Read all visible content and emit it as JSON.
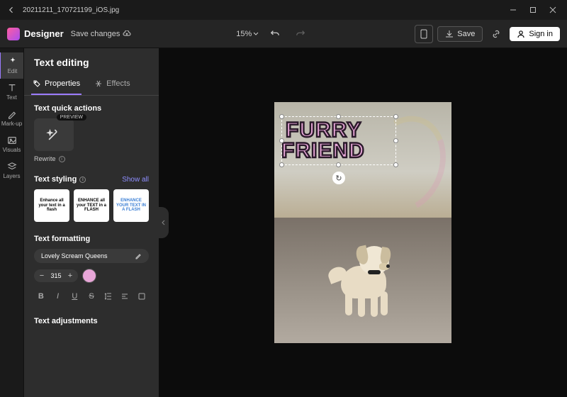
{
  "titlebar": {
    "filename": "20211211_170721199_iOS.jpg"
  },
  "toolbar": {
    "brand": "Designer",
    "save_changes": "Save changes",
    "zoom": "15%",
    "save_label": "Save",
    "signin_label": "Sign in"
  },
  "rail": {
    "items": [
      {
        "label": "Edit"
      },
      {
        "label": "Text"
      },
      {
        "label": "Mark-up"
      },
      {
        "label": "Visuals"
      },
      {
        "label": "Layers"
      }
    ]
  },
  "panel": {
    "title": "Text editing",
    "tabs": {
      "properties": "Properties",
      "effects": "Effects"
    },
    "quick_actions_title": "Text quick actions",
    "preview_badge": "PREVIEW",
    "rewrite_label": "Rewrite",
    "styling_title": "Text styling",
    "show_all": "Show all",
    "style_cards": [
      "Enhance all your text in a flash",
      "ENHANCE all your TEXT in a FLASH",
      "ENHANCE YOUR TEXT IN A FLASH"
    ],
    "formatting_title": "Text formatting",
    "font_name": "Lovely Scream Queens",
    "font_size": "315",
    "color": "#e8a6d8",
    "adjustments_title": "Text adjustments"
  },
  "canvas": {
    "text_line1": "FURRY",
    "text_line2": "FRIEND"
  }
}
